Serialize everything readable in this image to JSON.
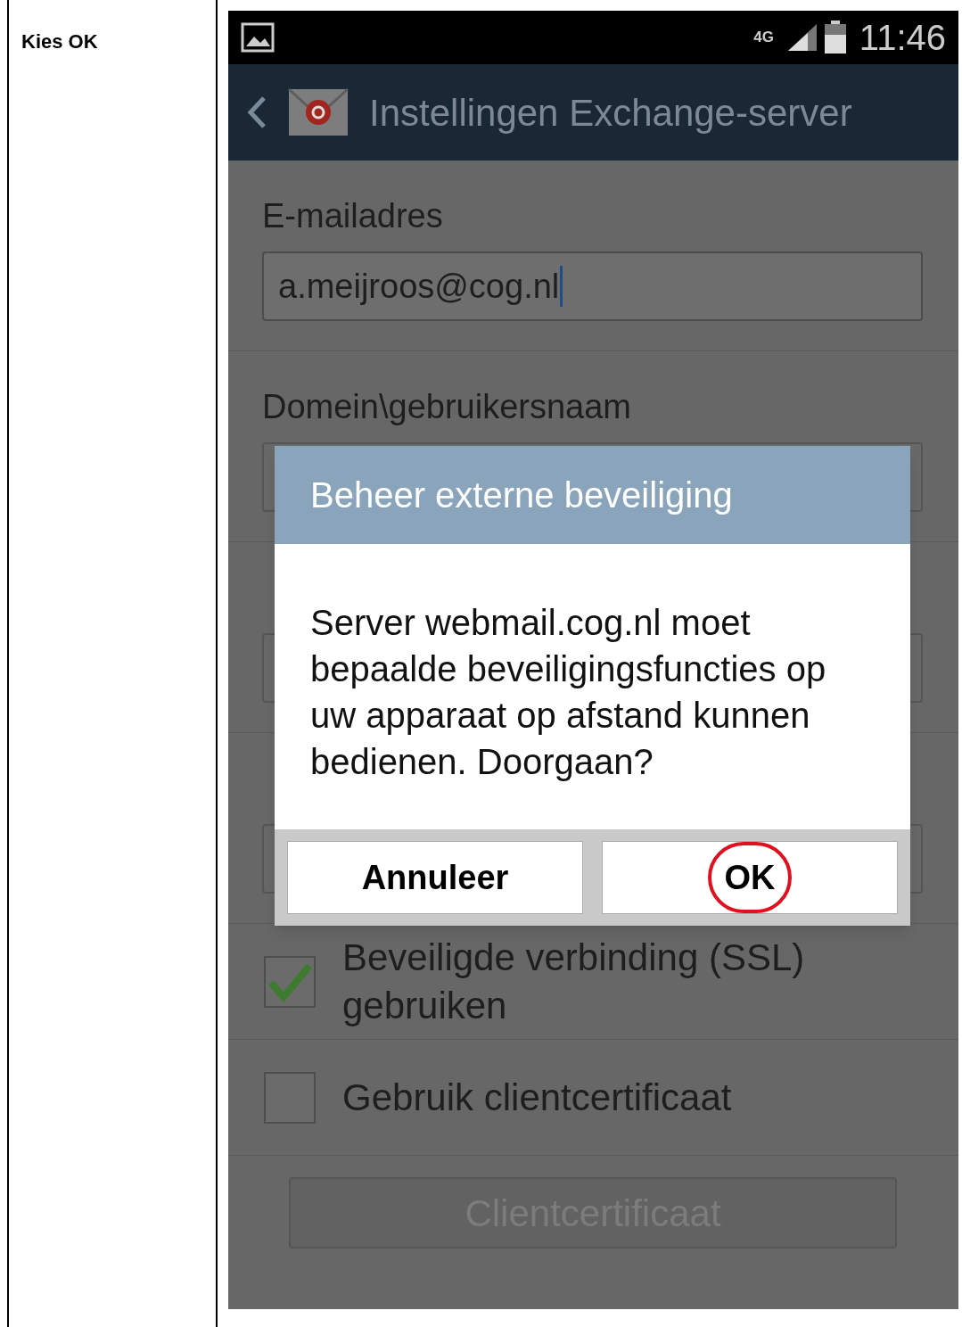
{
  "instruction": "Kies OK",
  "status_bar": {
    "network": "4G",
    "time": "11:46"
  },
  "app_bar": {
    "title": "Instellingen Exchange-server"
  },
  "fields": [
    {
      "label": "E-mailadres",
      "value": "a.meijroos@cog.nl",
      "focused": true
    },
    {
      "label": "Domein\\gebruikersnaam"
    }
  ],
  "options": [
    {
      "label": "Beveiligde verbinding (SSL) gebruiken",
      "checked": true
    },
    {
      "label": "Gebruik clientcertificaat",
      "checked": false
    }
  ],
  "cert_button": {
    "label": "Clientcertificaat",
    "disabled": true
  },
  "dialog": {
    "title": "Beheer externe beveiliging",
    "message": "Server webmail.cog.nl moet bepaalde beveiligingsfuncties op uw apparaat op afstand kunnen bedienen. Doorgaan?",
    "buttons": [
      {
        "label": "Annuleer",
        "highlighted": false
      },
      {
        "label": "OK",
        "highlighted": true
      }
    ]
  }
}
